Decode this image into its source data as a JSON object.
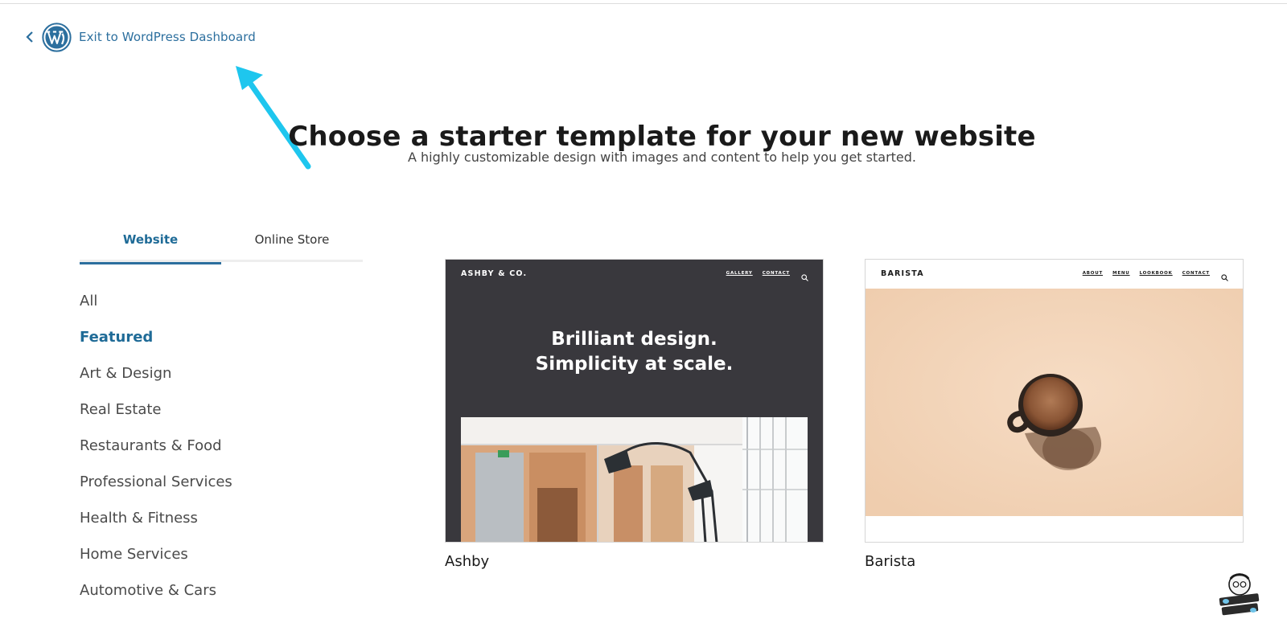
{
  "header": {
    "exit_label": "Exit to WordPress Dashboard"
  },
  "hero": {
    "title": "Choose a starter template for your new website",
    "subtitle": "A highly customizable design with images and content to help you get started."
  },
  "tabs": [
    {
      "label": "Website",
      "active": true
    },
    {
      "label": "Online Store",
      "active": false
    }
  ],
  "categories": [
    {
      "label": "All",
      "selected": false
    },
    {
      "label": "Featured",
      "selected": true
    },
    {
      "label": "Art & Design",
      "selected": false
    },
    {
      "label": "Real Estate",
      "selected": false
    },
    {
      "label": "Restaurants & Food",
      "selected": false
    },
    {
      "label": "Professional Services",
      "selected": false
    },
    {
      "label": "Health & Fitness",
      "selected": false
    },
    {
      "label": "Home Services",
      "selected": false
    },
    {
      "label": "Automotive & Cars",
      "selected": false
    }
  ],
  "templates": [
    {
      "name": "Ashby",
      "brand": "ASHBY & CO.",
      "nav": [
        "GALLERY",
        "CONTACT"
      ],
      "headline_1": "Brilliant design.",
      "headline_2": "Simplicity at scale."
    },
    {
      "name": "Barista",
      "brand": "BARISTA",
      "nav": [
        "ABOUT",
        "MENU",
        "LOOKBOOK",
        "CONTACT"
      ]
    }
  ],
  "colors": {
    "accent": "#2c6f9e",
    "annotation_arrow": "#1ec6ee",
    "ashby_bg": "#39383d",
    "barista_bg": "#f2d3b6"
  },
  "icons": [
    "chevron-left-icon",
    "wordpress-logo-icon",
    "search-icon",
    "watermark-logo"
  ],
  "watermark": "one smart sheep"
}
